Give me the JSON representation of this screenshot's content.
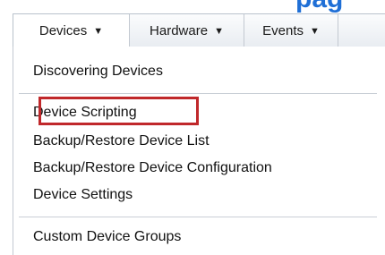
{
  "heading": {
    "fragment": "pag"
  },
  "menubar": {
    "tabs": [
      {
        "label": "Devices",
        "caret": "▼"
      },
      {
        "label": "Hardware",
        "caret": "▼"
      },
      {
        "label": "Events",
        "caret": "▼"
      }
    ]
  },
  "dropdown": {
    "items": [
      {
        "label": "Discovering Devices"
      },
      {
        "label": "Device Scripting",
        "highlighted": true
      },
      {
        "label": "Backup/Restore Device List"
      },
      {
        "label": "Backup/Restore Device Configuration"
      },
      {
        "label": "Device Settings"
      },
      {
        "label": "Custom Device Groups"
      }
    ]
  },
  "colors": {
    "highlight_border": "#c0282b",
    "heading_blue": "#1f6fd6"
  }
}
